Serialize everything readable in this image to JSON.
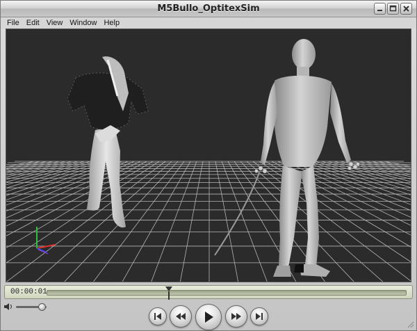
{
  "window": {
    "title": "M5Bullo_OptitexSim",
    "controls": [
      "minimize-icon",
      "maximize-icon",
      "close-icon"
    ]
  },
  "menu": {
    "items": [
      "File",
      "Edit",
      "View",
      "Window",
      "Help"
    ]
  },
  "viewport": {
    "background": "#2b2b2b",
    "grid_color": "#d8d8d8",
    "axis_colors": {
      "x": "#e03030",
      "y": "#30c040",
      "z": "#3050e0"
    }
  },
  "timeline": {
    "timecode": "00:00:01",
    "playhead_fraction": 0.34
  },
  "volume": {
    "level_fraction": 0.85,
    "icon": "speaker-icon"
  },
  "transport": {
    "buttons": [
      "go-to-start-icon",
      "rewind-icon",
      "play-icon",
      "fast-forward-icon",
      "go-to-end-icon"
    ]
  },
  "colors": {
    "chrome": "#d0d0d0",
    "timeline_bg": "#dfe4cf"
  }
}
